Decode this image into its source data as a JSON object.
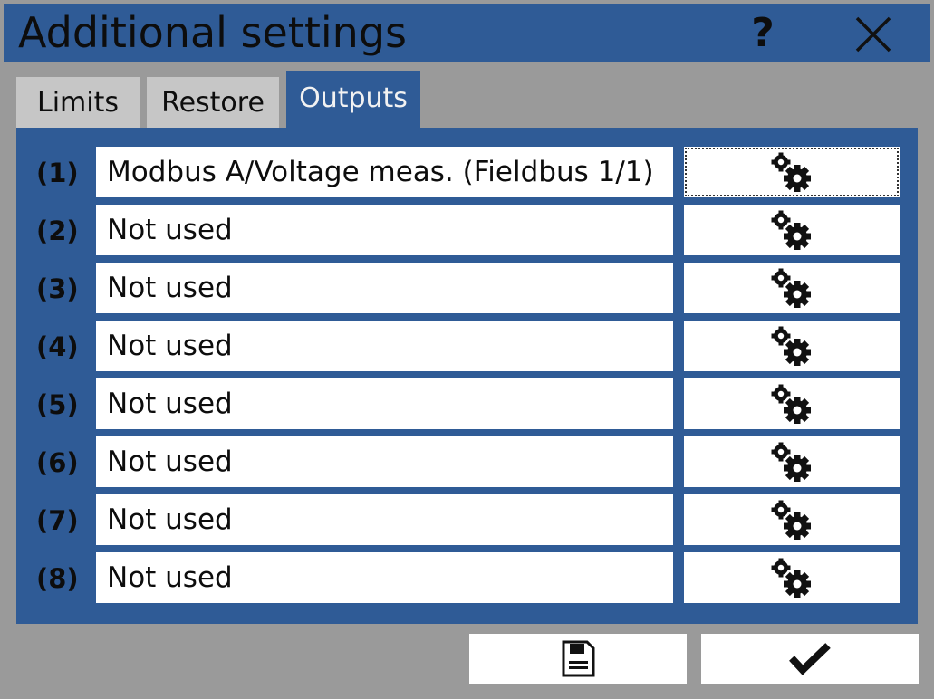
{
  "window": {
    "title": "Additional settings",
    "help_label": "?",
    "close_icon": "close-icon"
  },
  "tabs": [
    {
      "label": "Limits",
      "active": false
    },
    {
      "label": "Restore",
      "active": false
    },
    {
      "label": "Outputs",
      "active": true
    }
  ],
  "outputs": [
    {
      "num": "(1)",
      "value": "Modbus A/Voltage meas. (Fieldbus 1/1)",
      "icon": "gears-icon",
      "focused": true
    },
    {
      "num": "(2)",
      "value": "Not used",
      "icon": "gears-icon"
    },
    {
      "num": "(3)",
      "value": "Not used",
      "icon": "gears-icon"
    },
    {
      "num": "(4)",
      "value": "Not used",
      "icon": "gears-icon"
    },
    {
      "num": "(5)",
      "value": "Not used",
      "icon": "gears-icon"
    },
    {
      "num": "(6)",
      "value": "Not used",
      "icon": "gears-icon"
    },
    {
      "num": "(7)",
      "value": "Not used",
      "icon": "gears-icon"
    },
    {
      "num": "(8)",
      "value": "Not used",
      "icon": "gears-icon"
    }
  ],
  "footer": {
    "save_icon": "save-document-icon",
    "confirm_icon": "checkmark-icon"
  },
  "colors": {
    "accent": "#2f5b96",
    "background": "#9a9a9a",
    "inactive_tab": "#c6c6c6"
  }
}
